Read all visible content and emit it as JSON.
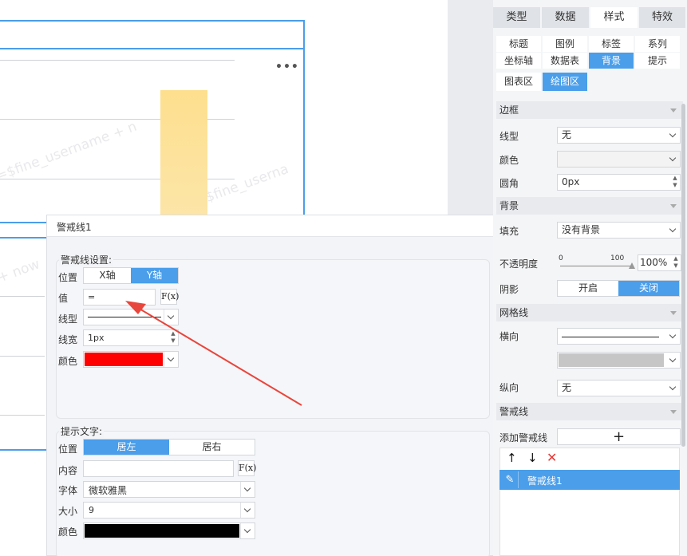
{
  "canvas": {
    "watermark_1": "=$fine_username + n",
    "watermark_2": "$fine_userna",
    "watermark_3": "+ now"
  },
  "dialog": {
    "title": "警戒线1",
    "line_settings": {
      "group_label": "警戒线设置:",
      "position_label": "位置",
      "axis_options": [
        "X轴",
        "Y轴"
      ],
      "selected_axis": "Y轴",
      "value_label": "值",
      "value": "=",
      "fx_label": "F(x)",
      "line_type_label": "线型",
      "line_width_label": "线宽",
      "line_width_value": "1px",
      "color_label": "颜色",
      "color_value": "#ff0000"
    },
    "tip_text": {
      "group_label": "提示文字:",
      "position_label": "位置",
      "position_options": [
        "居左",
        "居右"
      ],
      "selected_position": "居左",
      "content_label": "内容",
      "content_value": "",
      "fx_label": "F(x)",
      "font_label": "字体",
      "font_value": "微软雅黑",
      "size_label": "大小",
      "size_value": "9",
      "color_label": "颜色",
      "color_value": "#000000"
    }
  },
  "panel": {
    "tabs": [
      "类型",
      "数据",
      "样式",
      "特效"
    ],
    "active_tab": "样式",
    "subtabs_row1": [
      "标题",
      "图例",
      "标签",
      "系列"
    ],
    "subtabs_row2": [
      "坐标轴",
      "数据表",
      "背景",
      "提示"
    ],
    "active_subtab": "背景",
    "area_tabs": [
      "图表区",
      "绘图区"
    ],
    "active_area_tab": "绘图区",
    "border": {
      "section": "边框",
      "line_type_label": "线型",
      "line_type_value": "无",
      "color_label": "颜色",
      "radius_label": "圆角",
      "radius_value": "0px"
    },
    "background": {
      "section": "背景",
      "fill_label": "填充",
      "fill_value": "没有背景",
      "opacity_label": "不透明度",
      "slider_min": "0",
      "slider_max": "100",
      "opacity_value": "100%",
      "shadow_label": "阴影",
      "shadow_options": [
        "开启",
        "关闭"
      ],
      "shadow_selected": "关闭"
    },
    "grid": {
      "section": "网格线",
      "horizontal_label": "横向",
      "vertical_label": "纵向",
      "vertical_value": "无"
    },
    "alert_line": {
      "section": "警戒线",
      "add_label": "添加警戒线",
      "add_symbol": "+",
      "list": [
        "警戒线1"
      ]
    }
  },
  "colors": {
    "accent": "#4a9eea",
    "bar_fill": "#fde08f",
    "arrow": "#e8463c"
  }
}
